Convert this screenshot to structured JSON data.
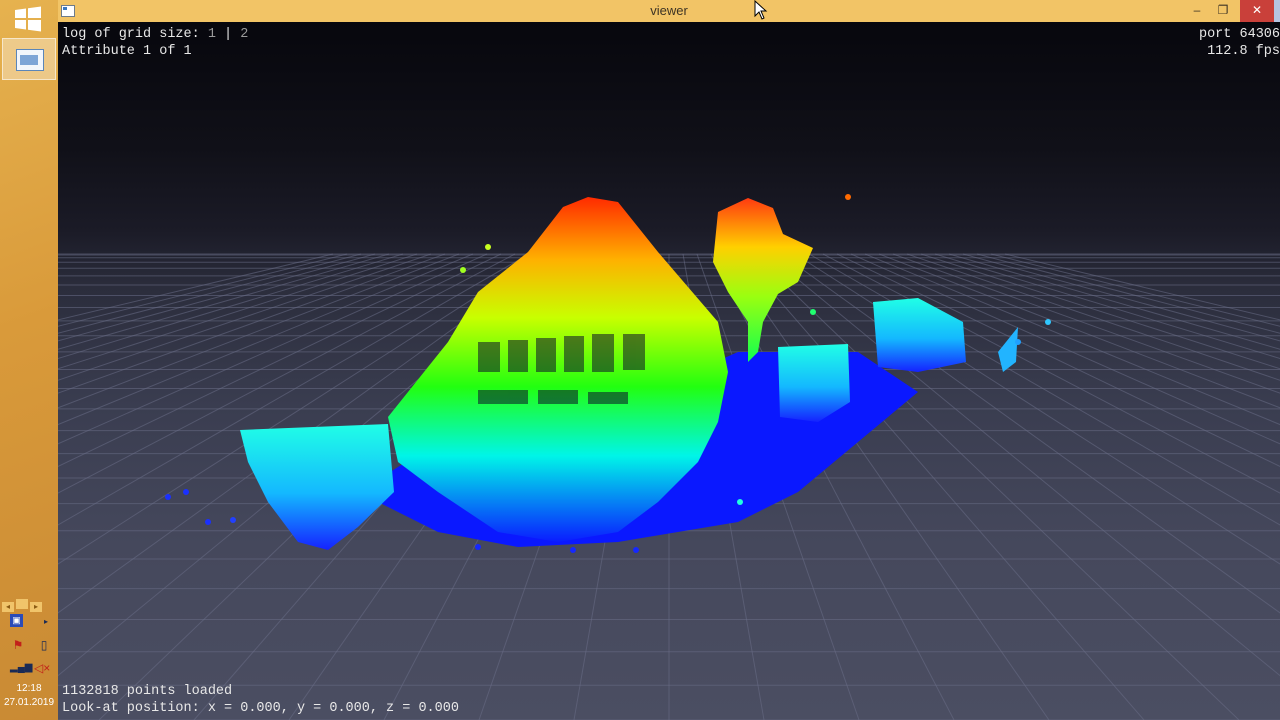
{
  "window": {
    "title": "viewer",
    "minimize_icon": "minimize-icon",
    "maximize_icon": "restore-icon",
    "close_icon": "close-icon"
  },
  "overlay": {
    "grid_label": "log of grid size: ",
    "grid_value_a": "1",
    "grid_sep": " | ",
    "grid_value_b": "2",
    "attribute": "Attribute 1 of 1",
    "port": "port 64306",
    "fps": "112.8 fps",
    "points_loaded": "1132818 points loaded",
    "lookat": "Look-at position: x = 0.000, y = 0.000, z = 0.000"
  },
  "taskbar": {
    "time": "12:18",
    "date": "27.01.2019"
  },
  "colors": {
    "taskbar": "#d99a3a",
    "titlebar": "#f2c466",
    "close": "#c9403a"
  }
}
